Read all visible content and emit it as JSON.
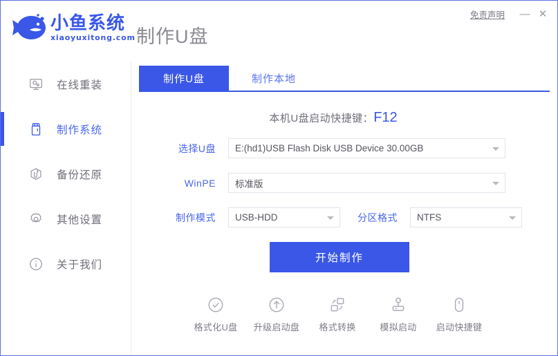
{
  "window": {
    "disclaimer": "免责声明",
    "minimize": "—",
    "close": "✕",
    "accent_color": "#3a57e8",
    "border_color": "#5b6fe0"
  },
  "brand": {
    "name_cn": "小鱼系统",
    "name_en": "xiaoyuxitong.com",
    "logo_icon": "fish-icon"
  },
  "header": {
    "title": "制作U盘"
  },
  "sidebar": {
    "items": [
      {
        "label": "在线重装",
        "icon": "monitor-icon",
        "active": false
      },
      {
        "label": "制作系统",
        "icon": "usb-drive-icon",
        "active": true
      },
      {
        "label": "备份还原",
        "icon": "backup-restore-icon",
        "active": false
      },
      {
        "label": "其他设置",
        "icon": "gear-icon",
        "active": false
      },
      {
        "label": "关于我们",
        "icon": "info-circle-icon",
        "active": false
      }
    ]
  },
  "main": {
    "tabs": [
      {
        "label": "制作U盘",
        "active": true
      },
      {
        "label": "制作本地",
        "active": false
      }
    ],
    "shortcut_prefix": "本机U盘启动快捷键：",
    "shortcut_key": "F12",
    "fields": {
      "usb_label": "选择U盘",
      "usb_value": "E:(hd1)USB Flash Disk USB Device 30.00GB",
      "winpe_label": "WinPE",
      "winpe_value": "标准版",
      "mode_label": "制作模式",
      "mode_value": "USB-HDD",
      "partition_label": "分区格式",
      "partition_value": "NTFS"
    },
    "start_button": "开始制作",
    "tools": [
      {
        "label": "格式化U盘",
        "icon": "check-circle-icon"
      },
      {
        "label": "升级启动盘",
        "icon": "arrow-up-circle-icon"
      },
      {
        "label": "格式转换",
        "icon": "format-convert-icon"
      },
      {
        "label": "模拟启动",
        "icon": "joystick-icon"
      },
      {
        "label": "启动快捷键",
        "icon": "mouse-icon"
      }
    ]
  }
}
